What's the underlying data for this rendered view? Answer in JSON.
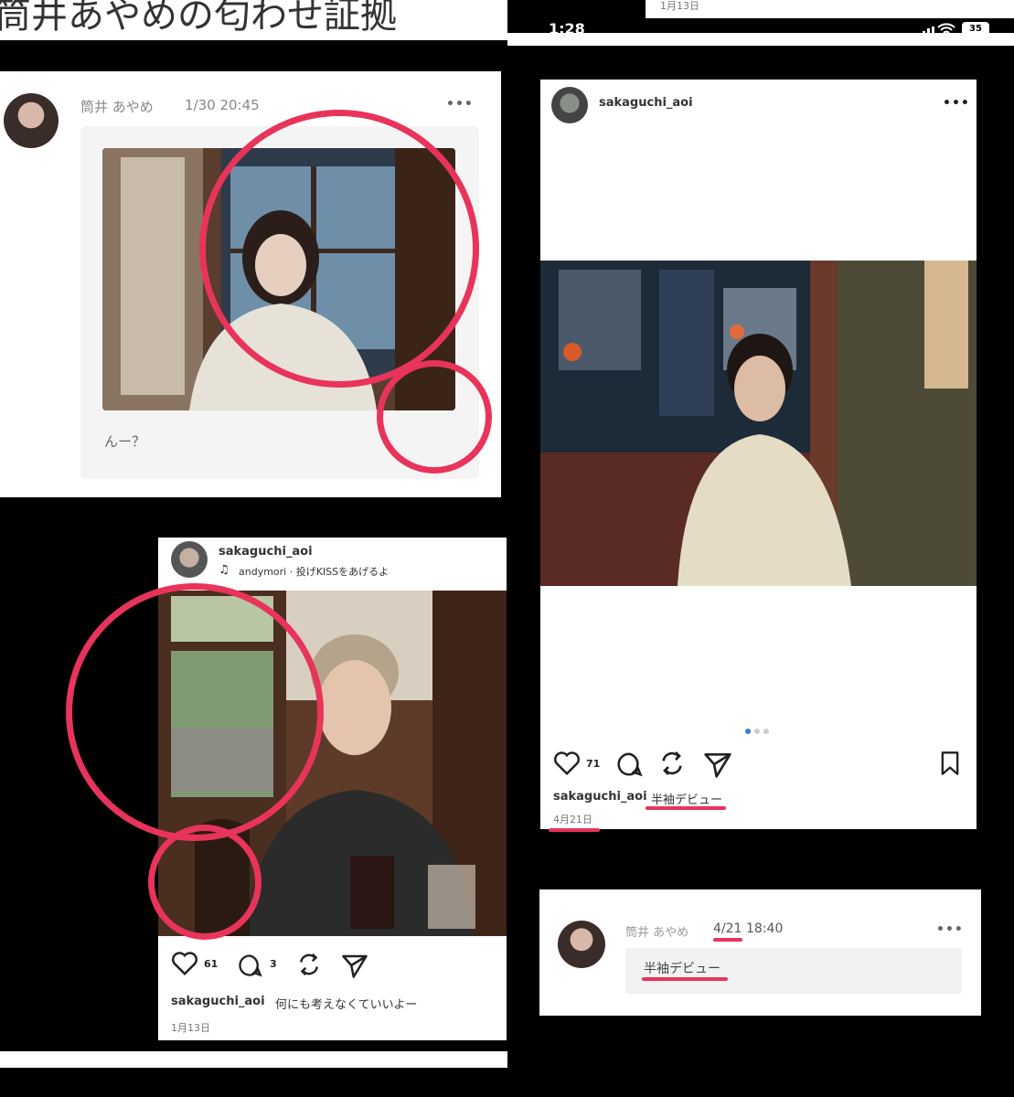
{
  "top_left": {
    "headline": "筒井あやめの匂わせ証拠",
    "thread": {
      "user": "筒井 あやめ",
      "time": "1/30 20:45",
      "more": "•••",
      "caption": "んー？"
    },
    "insta": {
      "handle": "sakaguchi_aoi",
      "music": "andymori · 投げKISSをあげるよ",
      "likes": "61",
      "comments": "3",
      "caption_user": "sakaguchi_aoi",
      "caption_text": "何にも考えなくていいよー",
      "date": "1月13日"
    }
  },
  "right": {
    "status_time": "1:28",
    "status_battery": "35",
    "top_date": "1月13日",
    "insta": {
      "handle": "sakaguchi_aoi",
      "more": "•••",
      "likes": "71",
      "caption_user": "sakaguchi_aoi",
      "caption_text": "半袖デビュー",
      "date": "4月21日"
    },
    "thread": {
      "user": "筒井 あやめ",
      "date": "4/21",
      "time": "18:40",
      "more": "•••",
      "caption": "半袖デビュー"
    }
  },
  "colors": {
    "highlight": "#e8345a",
    "bg": "#000000"
  }
}
